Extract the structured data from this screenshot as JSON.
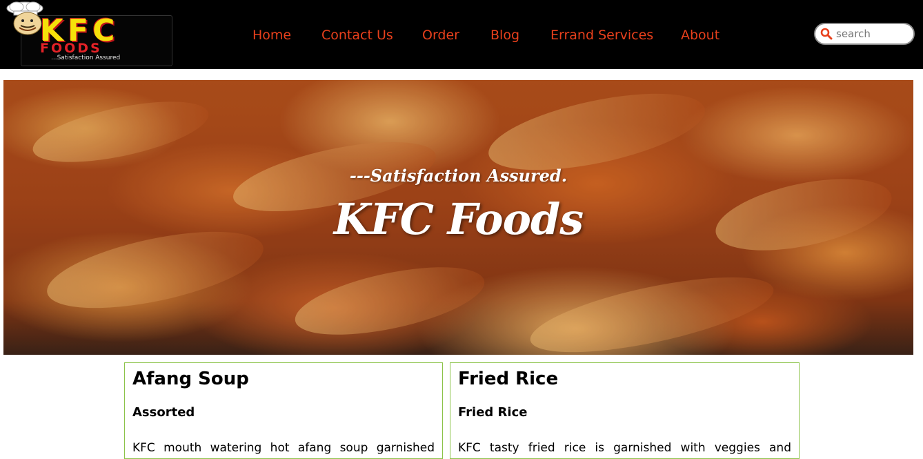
{
  "header": {
    "logo": {
      "brand": "KFC",
      "sub": "FOODS",
      "tagline": "...Satisfaction Assured"
    },
    "nav": [
      {
        "label": "Home"
      },
      {
        "label": "Contact Us"
      },
      {
        "label": "Order"
      },
      {
        "label": "Blog"
      },
      {
        "label": "Errand Services"
      },
      {
        "label": "About"
      }
    ],
    "search": {
      "placeholder": "search",
      "value": ""
    }
  },
  "hero": {
    "tagline": "---Satisfaction Assured.",
    "title": "KFC Foods"
  },
  "cards": [
    {
      "title": "Afang Soup",
      "subtitle": "Assorted",
      "text": "KFC mouth watering hot afang soup garnished"
    },
    {
      "title": "Fried Rice",
      "subtitle": "Fried Rice",
      "text": "KFC tasty fried rice is garnished with veggies and"
    }
  ],
  "colors": {
    "nav_link": "#e8401c",
    "header_bg": "#000000",
    "card_border": "#8cc34a",
    "search_icon": "#e8401c"
  },
  "icons": {
    "search": "search-icon",
    "chef": "chef-icon"
  }
}
